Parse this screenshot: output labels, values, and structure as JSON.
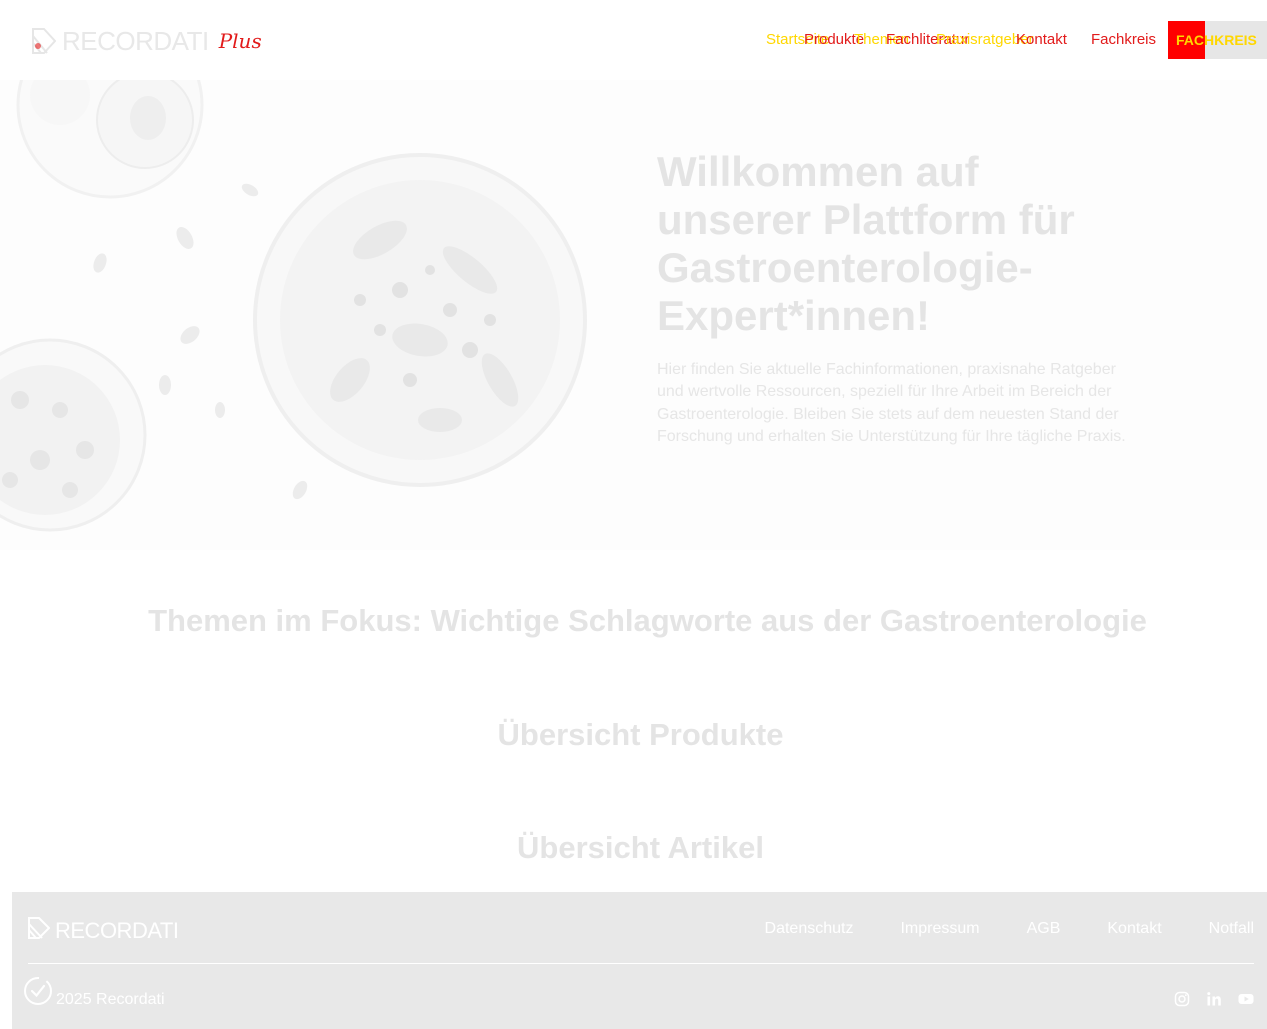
{
  "header": {
    "brand": "RECORDATI",
    "brand_script": "Plus",
    "nav": [
      {
        "label": "Startseite"
      },
      {
        "label": "Produkte"
      },
      {
        "label": "Themen"
      },
      {
        "label": "Fachliteratur"
      },
      {
        "label": "Praxisratgeber"
      },
      {
        "label": "Kontakt"
      },
      {
        "label": "Fachkreis"
      }
    ],
    "fach_button": "FACHKREIS",
    "accent_colors": {
      "yellow": "#ffd700",
      "red": "#ff0000"
    }
  },
  "hero": {
    "title": "Willkommen auf unserer Plattform für Gastroenterologie-Expert*innen!",
    "text": "Hier finden Sie aktuelle Fachinformationen, praxisnahe Ratgeber und wertvolle Ressourcen, speziell für Ihre Arbeit im Bereich der Gastroenterologie. Bleiben Sie stets auf dem neuesten Stand der Forschung und erhalten Sie Unterstützung für Ihre tägliche Praxis."
  },
  "sections": {
    "topics": "Themen im Fokus: Wichtige Schlagworte aus der Gastroenterologie",
    "products": "Übersicht Produkte",
    "articles": "Übersicht Artikel"
  },
  "footer": {
    "brand": "RECORDATI",
    "links": [
      "Datenschutz",
      "Impressum",
      "AGB",
      "Kontakt",
      "Notfall"
    ],
    "copyright": "2025 Recordati",
    "social": [
      "instagram-icon",
      "linkedin-icon",
      "youtube-icon"
    ],
    "background": "#e8e8e8"
  }
}
